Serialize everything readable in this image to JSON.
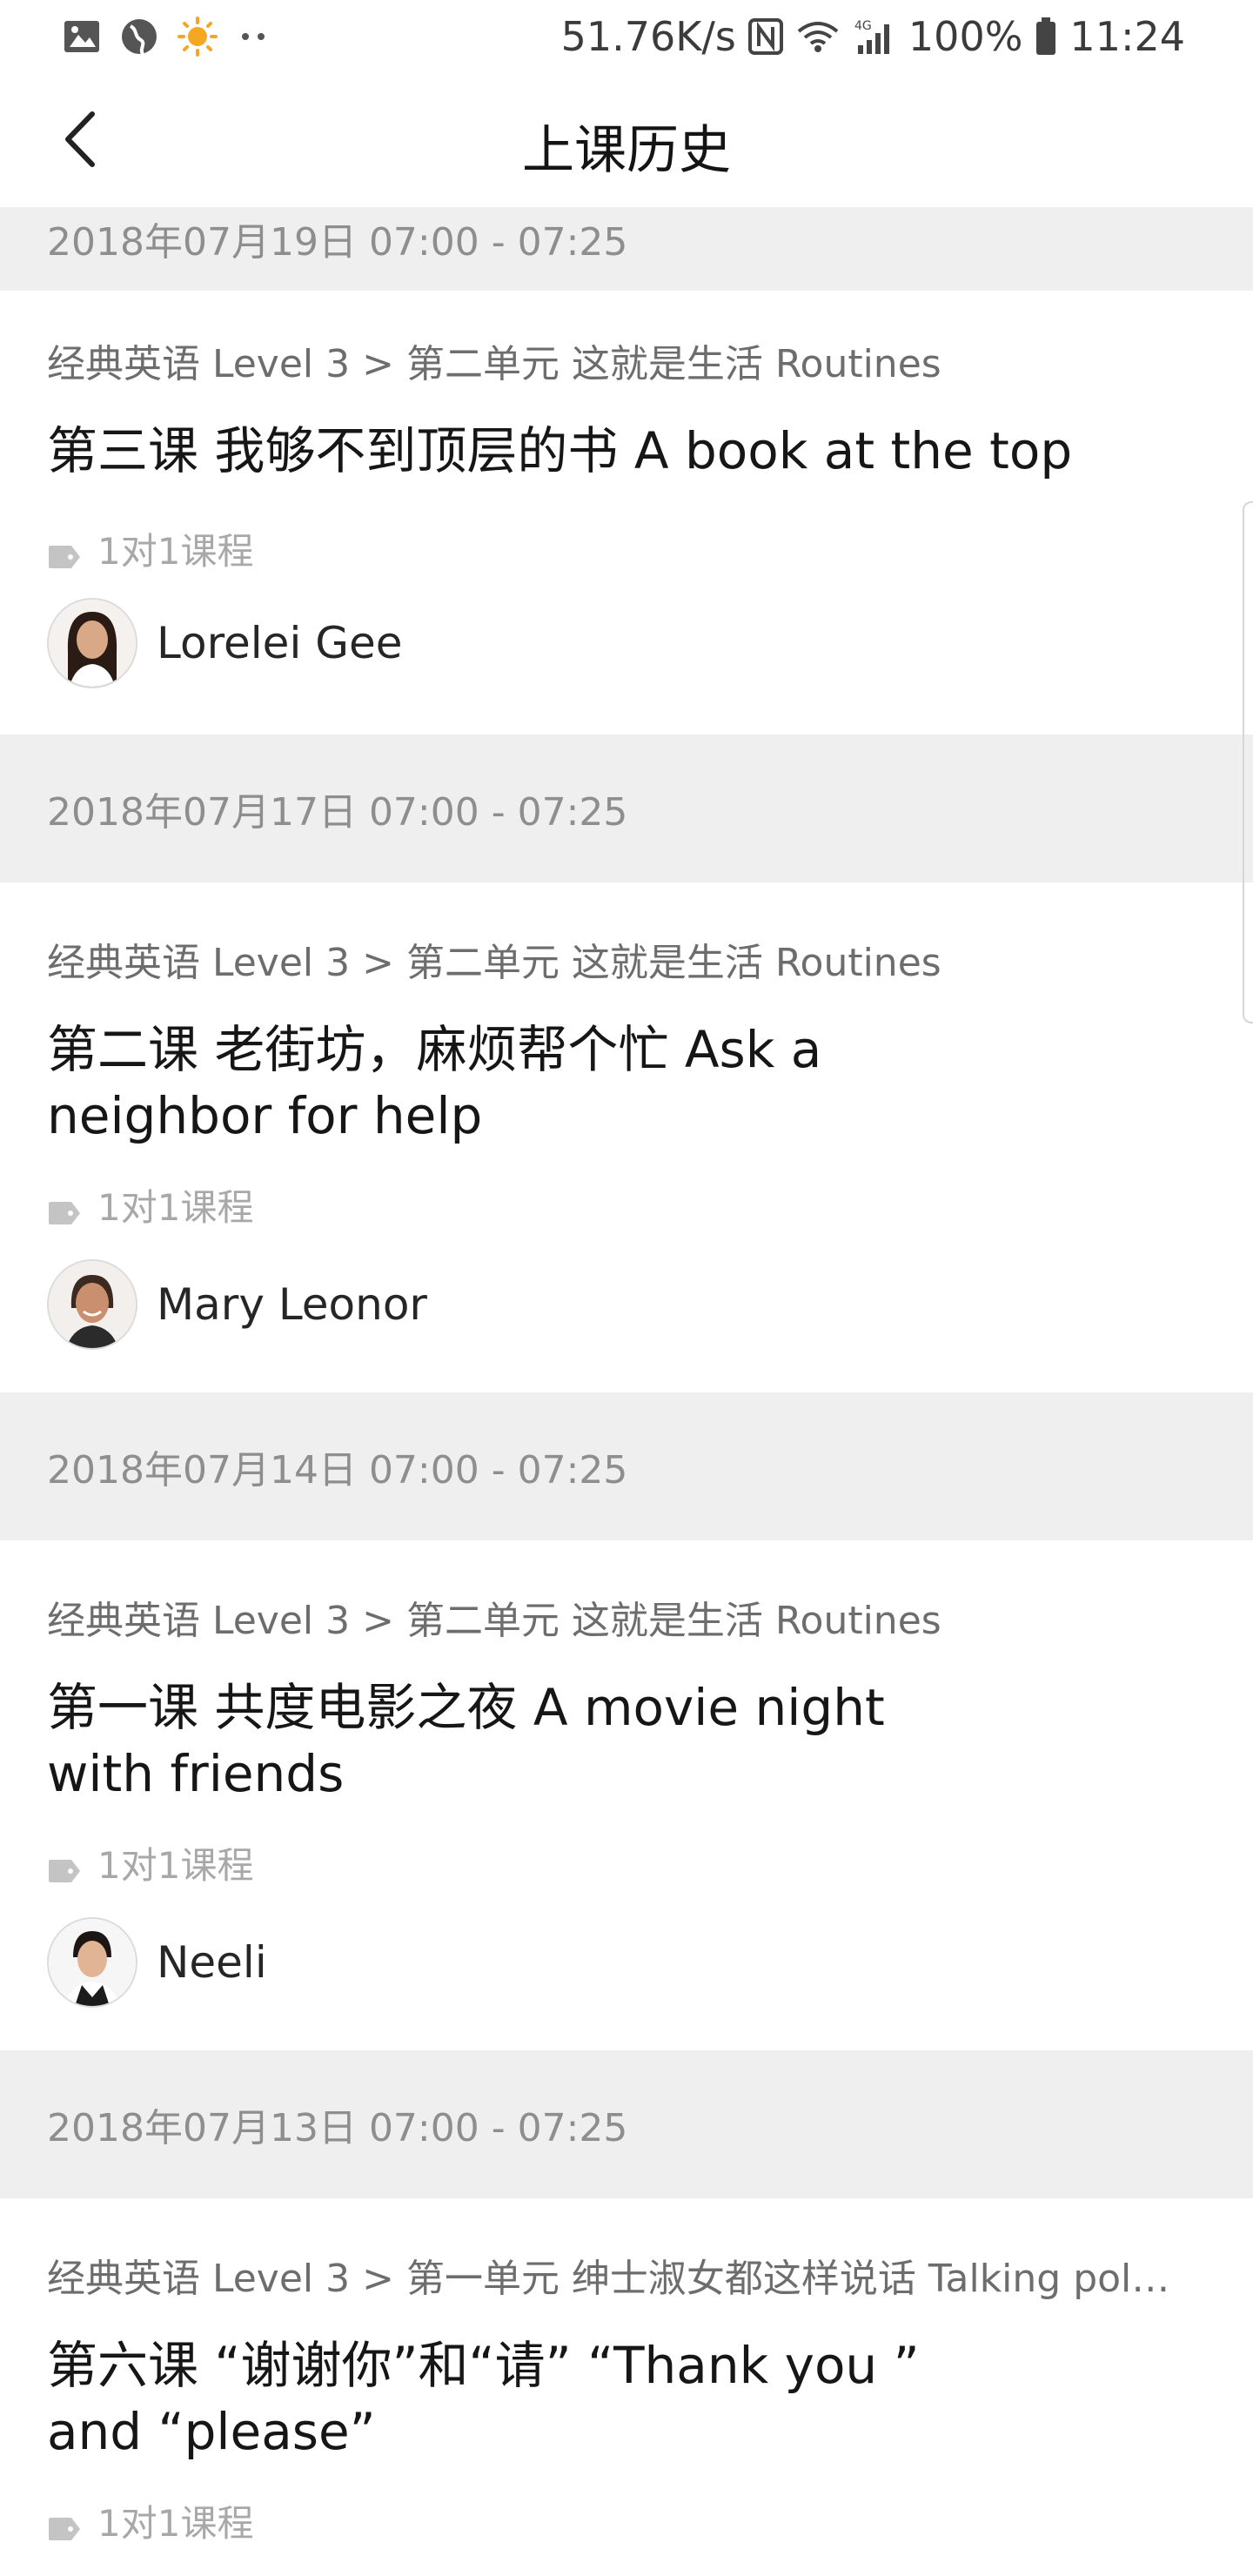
{
  "status_bar": {
    "left_icons": [
      "image-icon",
      "globe-icon",
      "sun-icon",
      "more-dots-icon"
    ],
    "network_speed": "51.76K/s",
    "right_icons": [
      "nfc-icon",
      "wifi-icon",
      "signal-4g-icon",
      "battery-icon"
    ],
    "battery": "100%",
    "time": "11:24"
  },
  "nav": {
    "back_icon": "chevron-left-icon",
    "title": "上课历史"
  },
  "lessons": [
    {
      "date": "2018年07月19日 07:00 - 07:25",
      "path": "经典英语 Level 3 > 第二单元 这就是生活 Routines",
      "title": "第三课 我够不到顶层的书 A book at the top",
      "tag": "1对1课程",
      "teacher": "Lorelei Gee"
    },
    {
      "date": "2018年07月17日 07:00 - 07:25",
      "path": "经典英语 Level 3 > 第二单元 这就是生活 Routines",
      "title": "第二课 老街坊，麻烦帮个忙 Ask a neighbor for help",
      "tag": "1对1课程",
      "teacher": "Mary Leonor"
    },
    {
      "date": "2018年07月14日 07:00 - 07:25",
      "path": "经典英语 Level 3 > 第二单元 这就是生活 Routines",
      "title": "第一课 共度电影之夜 A movie night with friends",
      "tag": "1对1课程",
      "teacher": "Neeli"
    },
    {
      "date": "2018年07月13日 07:00 - 07:25",
      "path": "经典英语 Level 3 > 第一单元 绅士淑女都这样说话 Talking pol…",
      "title": "第六课 “谢谢你”和“请” “Thank you ” and “please”",
      "tag": "1对1课程"
    }
  ]
}
